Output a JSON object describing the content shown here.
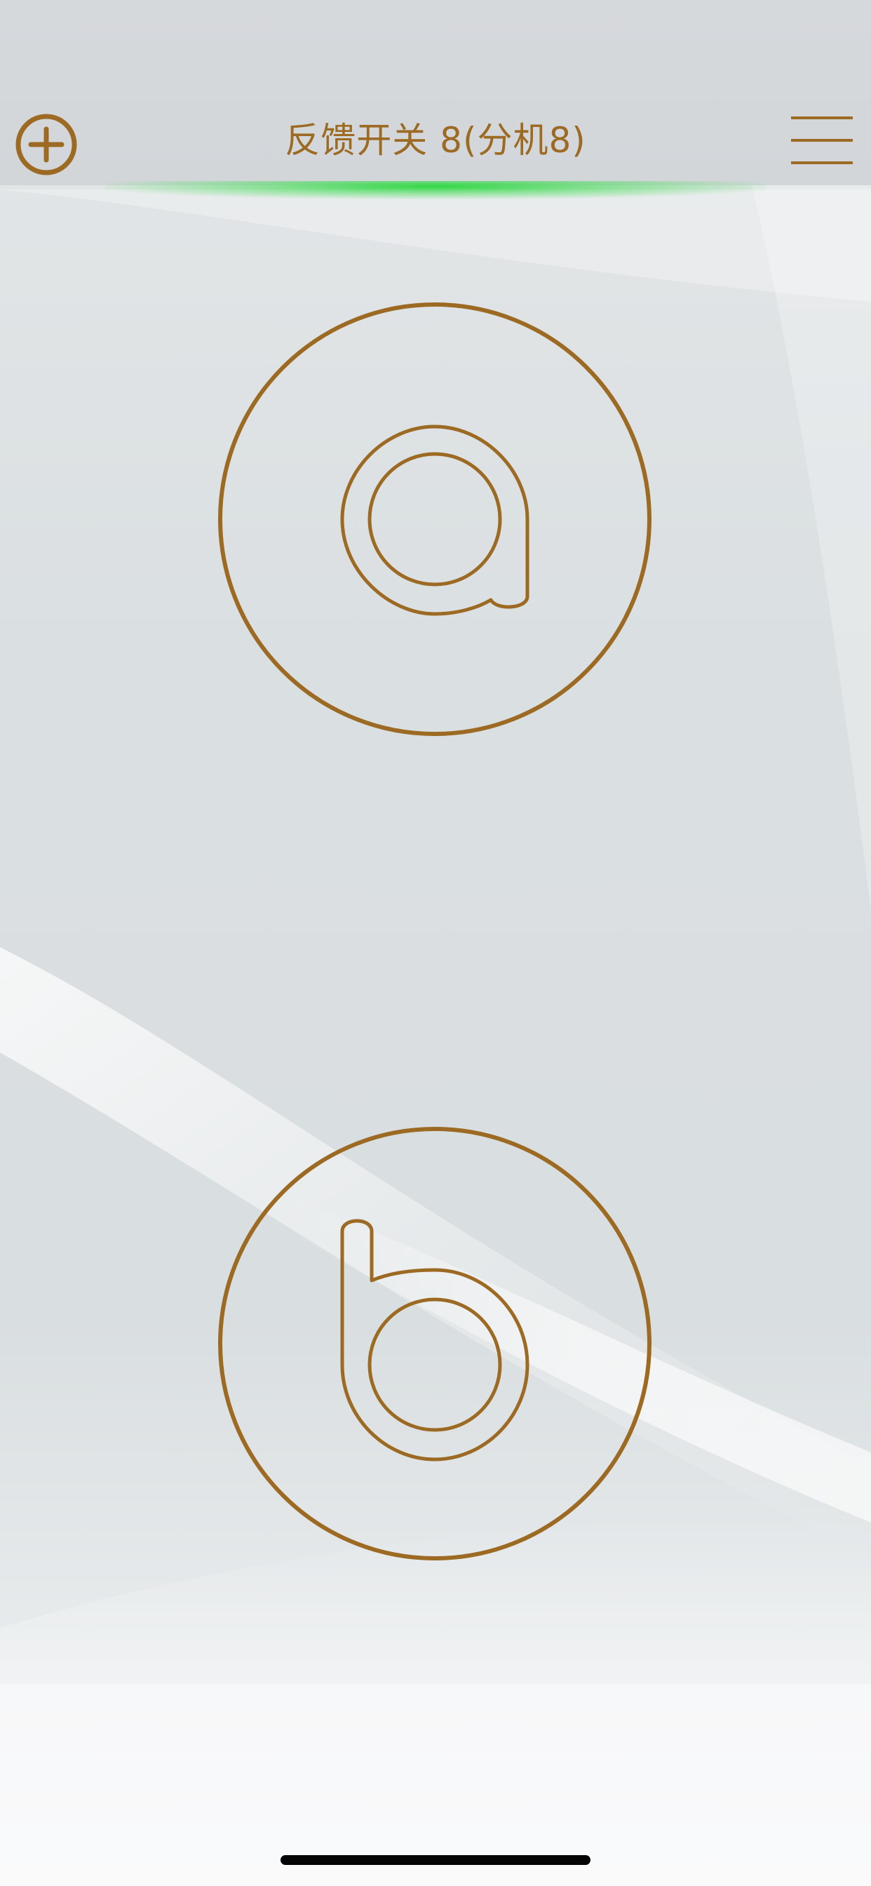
{
  "header": {
    "title": "反馈开关 8(分机8)",
    "add_icon": "plus-circle-icon",
    "menu_icon": "hamburger-menu-icon"
  },
  "switches": [
    {
      "icon": "letter-a-icon"
    },
    {
      "icon": "letter-b-icon"
    }
  ],
  "colors": {
    "accent": "#9c6a22",
    "glow": "#2fd84a",
    "header_bg": "#d4d8db",
    "home_indicator": "#050505"
  }
}
